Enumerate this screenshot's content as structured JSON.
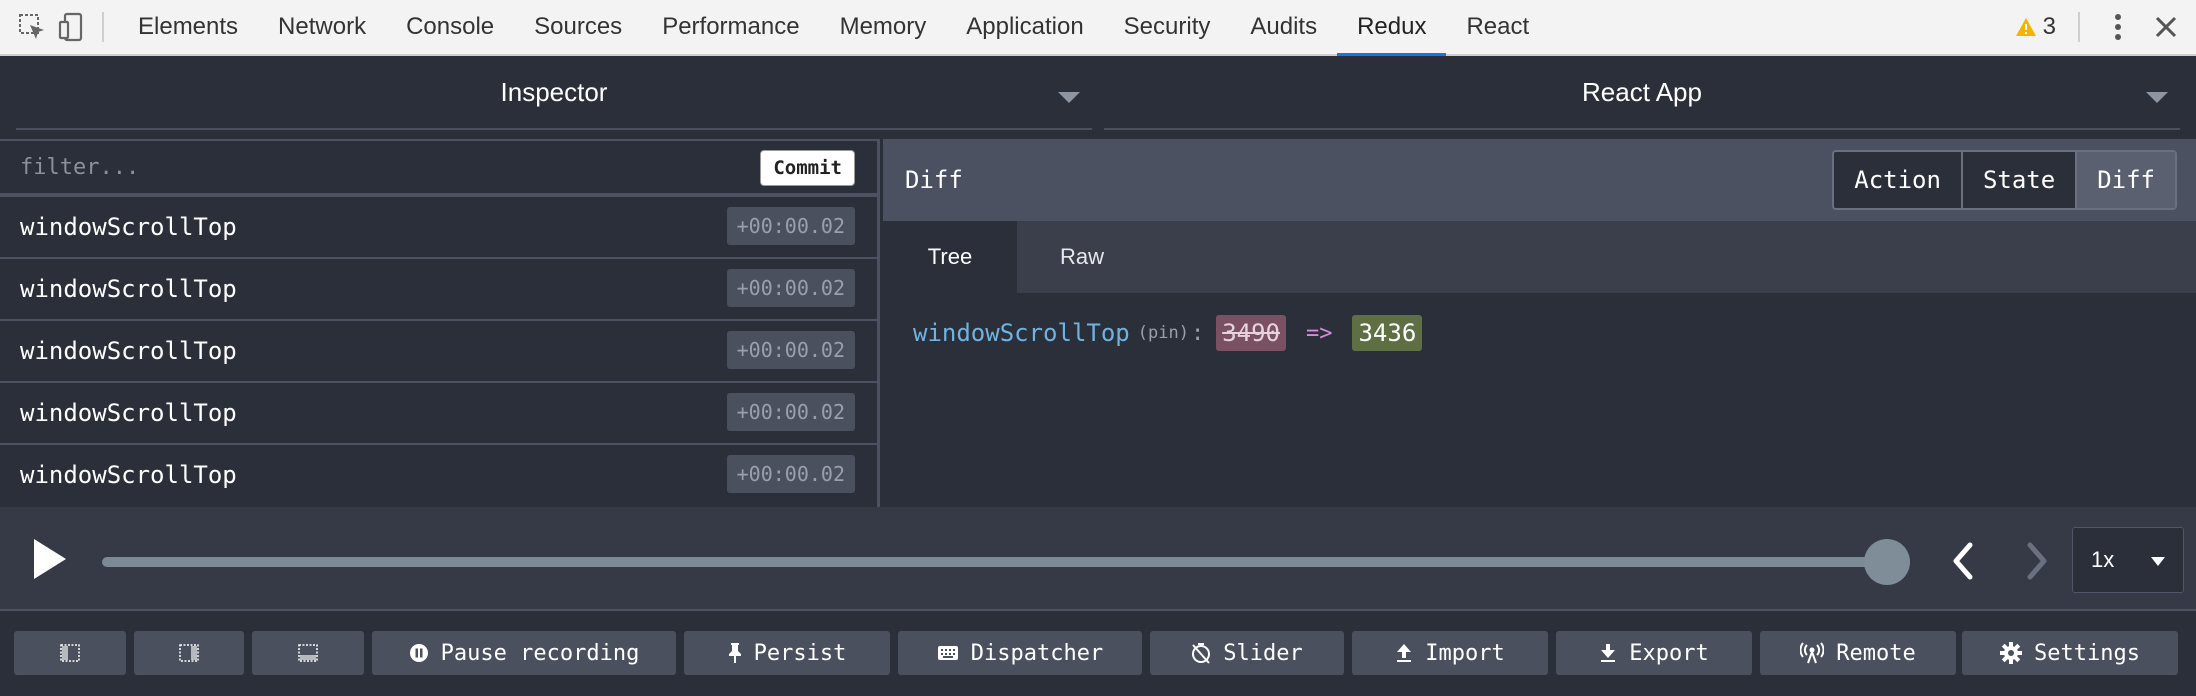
{
  "devtools": {
    "tabs": [
      "Elements",
      "Network",
      "Console",
      "Sources",
      "Performance",
      "Memory",
      "Application",
      "Security",
      "Audits",
      "Redux",
      "React"
    ],
    "active_tab": "Redux",
    "warning_count": "3"
  },
  "monitors": {
    "left_label": "Inspector",
    "right_label": "React App"
  },
  "actions": {
    "filter_placeholder": "filter...",
    "commit_label": "Commit",
    "items": [
      {
        "name": "windowScrollTop",
        "time": "+00:00.02"
      },
      {
        "name": "windowScrollTop",
        "time": "+00:00.02"
      },
      {
        "name": "windowScrollTop",
        "time": "+00:00.02"
      },
      {
        "name": "windowScrollTop",
        "time": "+00:00.02"
      },
      {
        "name": "windowScrollTop",
        "time": "+00:00.02"
      }
    ]
  },
  "diff": {
    "title": "Diff",
    "segments": [
      "Action",
      "State",
      "Diff"
    ],
    "active_segment": "Diff",
    "subtabs": [
      "Tree",
      "Raw"
    ],
    "active_subtab": "Tree",
    "key": "windowScrollTop",
    "pin": "(pin)",
    "colon": ":",
    "old_value": "3490",
    "arrow": "=>",
    "new_value": "3436"
  },
  "slider": {
    "position_fraction": 1.0,
    "speed": "1x"
  },
  "footer": {
    "pause_label": "Pause recording",
    "persist_label": "Persist",
    "dispatcher_label": "Dispatcher",
    "slider_label": "Slider",
    "import_label": "Import",
    "export_label": "Export",
    "remote_label": "Remote",
    "settings_label": "Settings"
  },
  "colors": {
    "accent": "#1a73e8",
    "panel_bg": "#2a2f3a",
    "diff_old_bg": "#7a5163",
    "diff_new_bg": "#5f6f44",
    "warning": "#f4b400"
  }
}
